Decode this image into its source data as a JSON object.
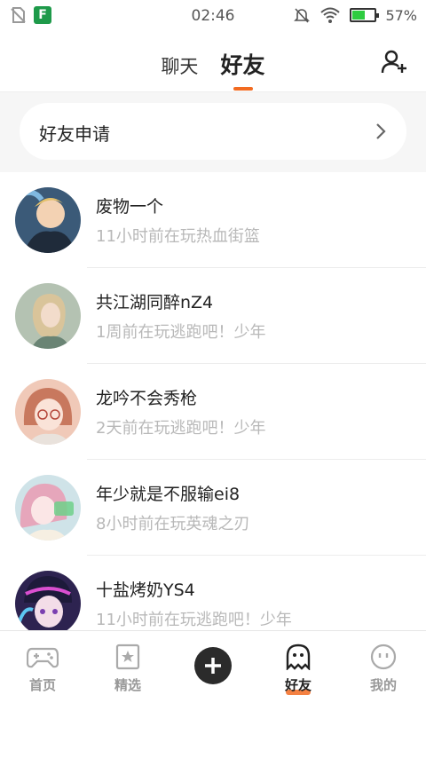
{
  "status_bar": {
    "time": "02:46",
    "battery_pct": "57%",
    "battery_level": 0.57,
    "app_badge": "F"
  },
  "header": {
    "tabs": [
      {
        "label": "聊天",
        "active": false
      },
      {
        "label": "好友",
        "active": true
      }
    ],
    "add_friend_icon": "add-user-icon"
  },
  "friend_requests": {
    "label": "好友申请",
    "icon": "chevron-right-icon"
  },
  "friends": [
    {
      "name": "废物一个",
      "status": "11小时前在玩热血街篮",
      "avatar_color": "#3b5a78"
    },
    {
      "name": "共江湖同醉nZ4",
      "status": "1周前在玩逃跑吧！少年",
      "avatar_color": "#a9b7a8"
    },
    {
      "name": "龙吟不会秀枪",
      "status": "2天前在玩逃跑吧！少年",
      "avatar_color": "#e8b7a4"
    },
    {
      "name": "年少就是不服输ei8",
      "status": "8小时前在玩英魂之刃",
      "avatar_color": "#dca9b8"
    },
    {
      "name": "十盐烤奶YS4",
      "status": "11小时前在玩逃跑吧！少年",
      "avatar_color": "#4a3a78"
    }
  ],
  "bottom_nav": {
    "items": [
      {
        "label": "首页",
        "icon": "gamepad-icon"
      },
      {
        "label": "精选",
        "icon": "star-bookmark-icon"
      },
      {
        "label": "",
        "icon": "plus-icon"
      },
      {
        "label": "好友",
        "icon": "ghost-icon",
        "active": true
      },
      {
        "label": "我的",
        "icon": "smiley-icon"
      }
    ]
  },
  "colors": {
    "accent": "#f26b21",
    "muted_text": "#b8b8b8",
    "dark_button": "#2b2b2b"
  }
}
